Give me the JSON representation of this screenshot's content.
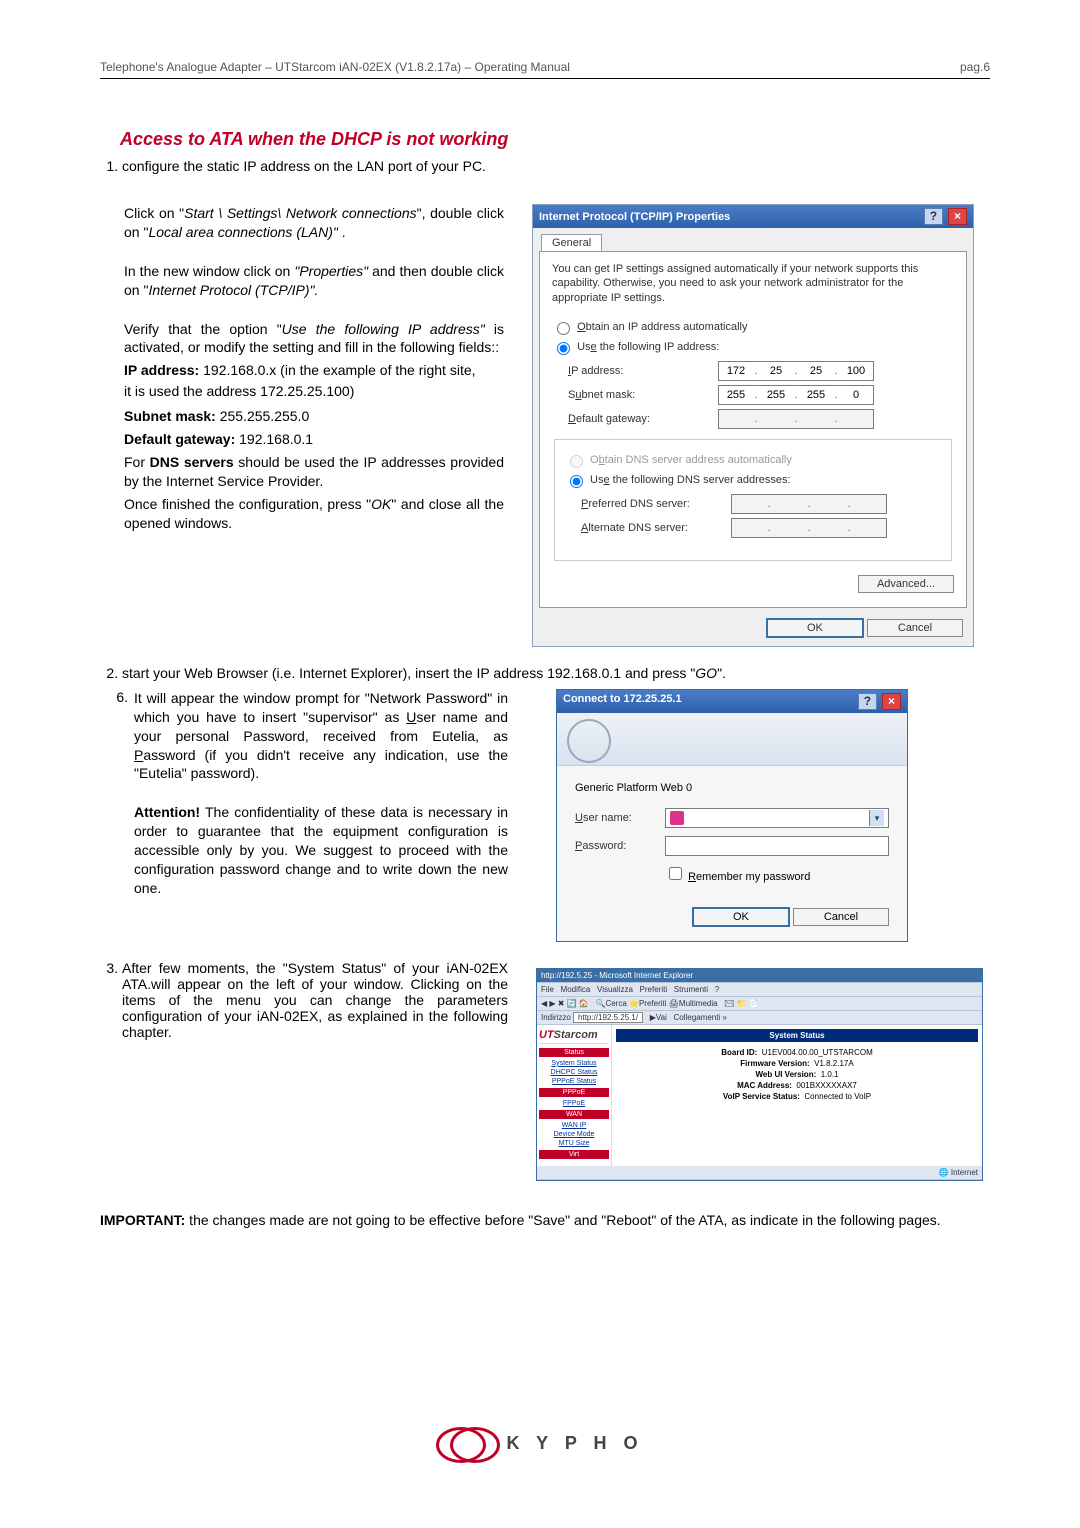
{
  "header": {
    "left": "Telephone's Analogue Adapter  –  UTStarcom iAN-02EX (V1.8.2.17a) – Operating Manual",
    "right": "pag.6"
  },
  "heading": "Access to ATA when the DHCP is not working",
  "step1": "configure the static IP address on the LAN port of your PC.",
  "para1a": "Click on \"",
  "para1b": "Start \\ Settings\\ Network connections",
  "para1c": "\", double click on \"",
  "para1d": "Local area connections (LAN)\"",
  "para1e": " .",
  "para2a": "In the new window click on ",
  "para2b": "\"Properties\"",
  "para2c": " and then double click on  \"",
  "para2d": "Internet Protocol (TCP/IP)\".",
  "para3a": "Verify that the option \"",
  "para3b": "Use the following IP address\"",
  "para3c": " is activated, or modify the setting and fill in the following fields::",
  "ip_lbl": "IP address:",
  "ip_val": " 192.168.0.x (in the example of the right site,",
  "ip_val2": "it is used the address 172.25.25.100)",
  "subnet_lbl": "Subnet mask:",
  "subnet_val": " 255.255.255.0",
  "gw_lbl": "Default gateway:",
  "gw_val": " 192.168.0.1",
  "dns_a": "For ",
  "dns_b": "DNS servers",
  "dns_c": " should be used the IP addresses provided by the Internet Service Provider.",
  "close_a": "Once finished the configuration, press \"",
  "close_b": "OK",
  "close_c": "\" and close all the opened windows.",
  "tcpip": {
    "title": "Internet Protocol (TCP/IP) Properties",
    "tab": "General",
    "desc": "You can get IP settings assigned automatically if your network supports this capability. Otherwise, you need to ask your network administrator for the appropriate IP settings.",
    "r1": "Obtain an IP address automatically",
    "r2": "Use the following IP address:",
    "ip_label": "IP address:",
    "ip": [
      "172",
      "25",
      "25",
      "100"
    ],
    "sm_label": "Subnet mask:",
    "sm": [
      "255",
      "255",
      "255",
      "0"
    ],
    "gw_label": "Default gateway:",
    "r3": "Obtain DNS server address automatically",
    "r4": "Use the following DNS server addresses:",
    "pdns": "Preferred DNS server:",
    "adns": "Alternate DNS server:",
    "adv": "Advanced...",
    "ok": "OK",
    "cancel": "Cancel"
  },
  "step2a": "start your Web Browser (i.e. Internet Explorer), insert the IP address 192.168.0.1 and press \"",
  "step2b": "GO",
  "step2c": "\".",
  "step6num": "6.",
  "step6a": "It will appear the window prompt for \"Network Password\" in which you have to insert \"supervisor\" as ",
  "step6_u": "U",
  "step6b": "ser name and your personal Password, received from Eutelia, as ",
  "step6_p": "P",
  "step6c": "assword (if you didn't receive any indication, use the \"Eutelia\" password).",
  "attn_lbl": "Attention!",
  "attn_txt": " The confidentiality of these data is necessary in order to guarantee that the equipment configuration is accessible only by you. We suggest to proceed with the configuration password change and to write down the new one.",
  "auth": {
    "title": "Connect to 172.25.25.1",
    "realm": "Generic Platform Web 0",
    "user": "User name:",
    "pass": "Password:",
    "remember": "Remember my password",
    "ok": "OK",
    "cancel": "Cancel"
  },
  "step3": "After few moments, the \"System Status\" of your iAN-02EX ATA.will appear on the left of your window. Clicking on the items of the menu you can change the parameters configuration of your iAN-02EX, as explained in the following chapter.",
  "browser": {
    "title": "http://192.5.25 - Microsoft Internet Explorer",
    "addr": "http://192.5.25.1/",
    "brand1": "UT",
    "brand2": "Starcom",
    "menu_status": "Status",
    "menu_sys": "System Status",
    "menu_dhcp": "DHCPC Status",
    "menu_pppoes": "PPPoE Status",
    "menu_pppoe": "PPPoE",
    "menu_fppoe": "FPPoE",
    "menu_wan": "WAN",
    "menu_wanip": "WAN IP",
    "menu_devmode": "Device Mode",
    "menu_mtusize": "MTU Size",
    "menu_virt": "Virt",
    "status_title": "System Status",
    "k1": "Board ID:",
    "v1": "U1EV004.00.00_UTSTARCOM",
    "k2": "Firmware Version:",
    "v2": "V1.8.2.17A",
    "k3": "Web UI Version:",
    "v3": "1.0.1",
    "k4": "MAC Address:",
    "v4": "001BXXXXXAX7",
    "k5": "VoIP Service Status:",
    "v5": "Connected to VoIP"
  },
  "important_lbl": "IMPORTANT:",
  "important_txt": " the changes made are not going to be effective before \"Save\" and \"Reboot\" of the ATA, as indicate in the following pages.",
  "logo": "K Y P H O"
}
